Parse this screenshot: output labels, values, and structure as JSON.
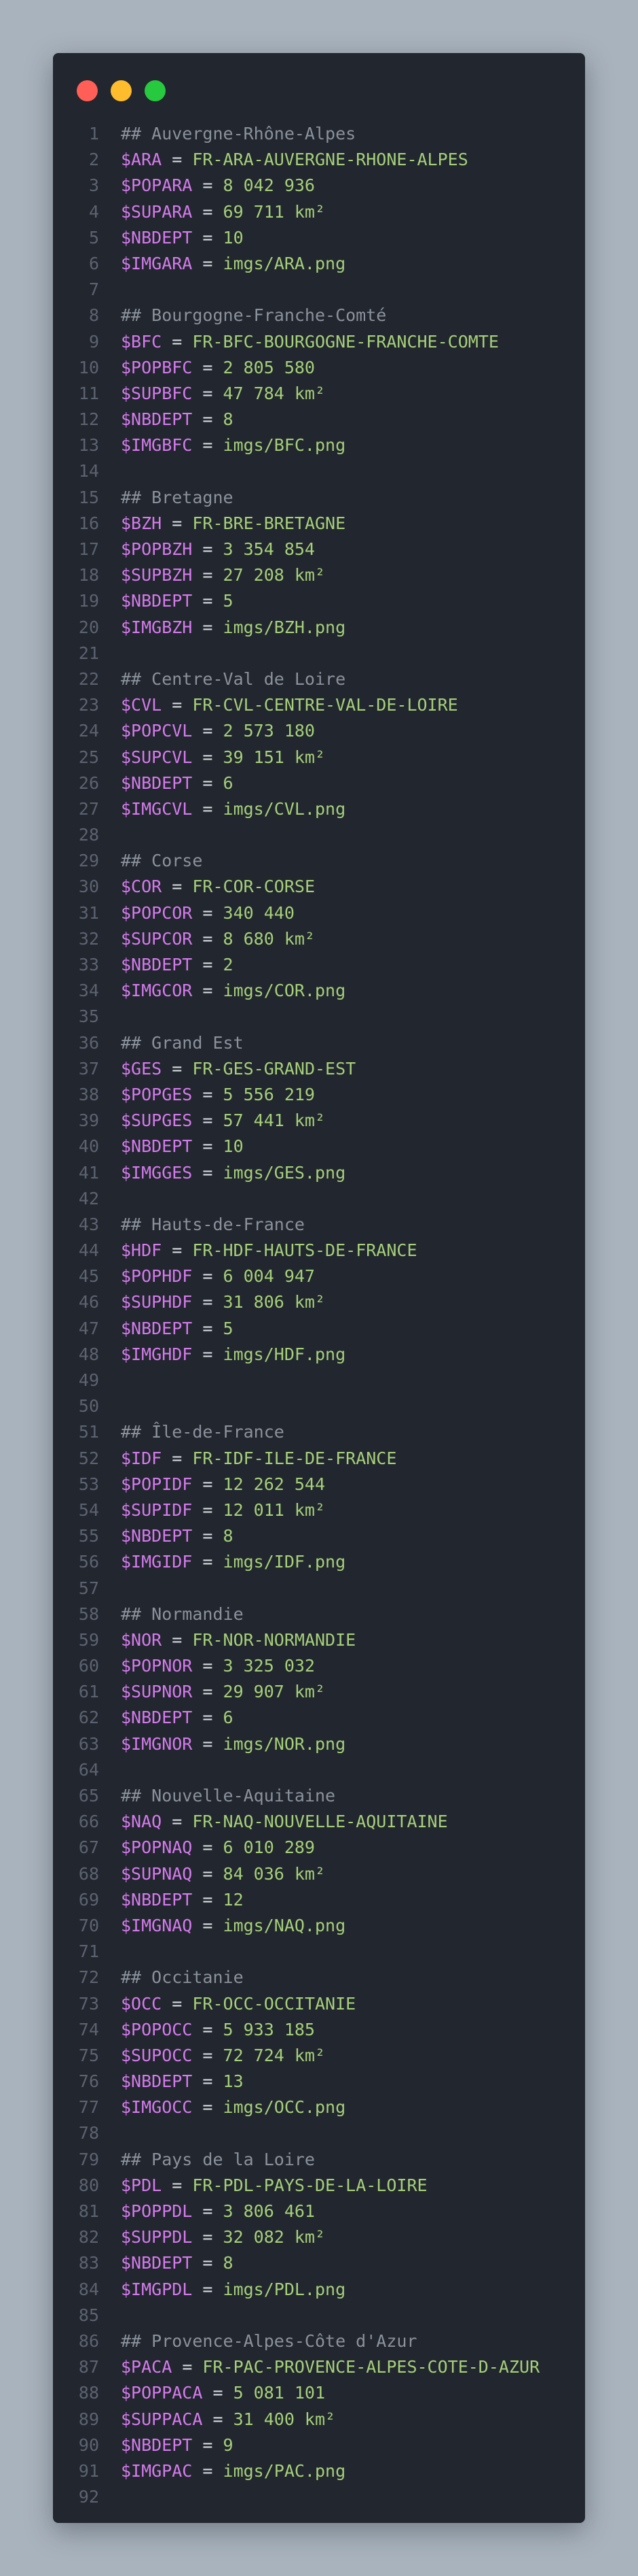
{
  "window": {
    "controls": [
      "close",
      "minimize",
      "maximize"
    ],
    "colors": {
      "close": "#ff5f56",
      "minimize": "#ffbd2e",
      "maximize": "#27c93f"
    }
  },
  "editor": {
    "lines": [
      {
        "n": "1",
        "type": "comment",
        "text": "## Auvergne-Rhône-Alpes"
      },
      {
        "n": "2",
        "type": "assign",
        "var": "$ARA",
        "op": " = ",
        "val": "FR-ARA-AUVERGNE-RHONE-ALPES"
      },
      {
        "n": "3",
        "type": "assign",
        "var": "$POPARA",
        "op": " = ",
        "val": "8 042 936"
      },
      {
        "n": "4",
        "type": "assign",
        "var": "$SUPARA",
        "op": " = ",
        "val": "69 711 km²"
      },
      {
        "n": "5",
        "type": "assign",
        "var": "$NBDEPT",
        "op": " = ",
        "val": "10"
      },
      {
        "n": "6",
        "type": "assign",
        "var": "$IMGARA",
        "op": " = ",
        "val": "imgs/ARA.png"
      },
      {
        "n": "7",
        "type": "blank"
      },
      {
        "n": "8",
        "type": "comment",
        "text": "## Bourgogne-Franche-Comté"
      },
      {
        "n": "9",
        "type": "assign",
        "var": "$BFC",
        "op": " = ",
        "val": "FR-BFC-BOURGOGNE-FRANCHE-COMTE"
      },
      {
        "n": "10",
        "type": "assign",
        "var": "$POPBFC",
        "op": " = ",
        "val": "2 805 580"
      },
      {
        "n": "11",
        "type": "assign",
        "var": "$SUPBFC",
        "op": " = ",
        "val": "47 784 km²"
      },
      {
        "n": "12",
        "type": "assign",
        "var": "$NBDEPT",
        "op": " = ",
        "val": "8"
      },
      {
        "n": "13",
        "type": "assign",
        "var": "$IMGBFC",
        "op": " = ",
        "val": "imgs/BFC.png"
      },
      {
        "n": "14",
        "type": "blank"
      },
      {
        "n": "15",
        "type": "comment",
        "text": "## Bretagne"
      },
      {
        "n": "16",
        "type": "assign",
        "var": "$BZH",
        "op": " = ",
        "val": "FR-BRE-BRETAGNE"
      },
      {
        "n": "17",
        "type": "assign",
        "var": "$POPBZH",
        "op": " = ",
        "val": "3 354 854"
      },
      {
        "n": "18",
        "type": "assign",
        "var": "$SUPBZH",
        "op": " = ",
        "val": "27 208 km²"
      },
      {
        "n": "19",
        "type": "assign",
        "var": "$NBDEPT",
        "op": " = ",
        "val": "5"
      },
      {
        "n": "20",
        "type": "assign",
        "var": "$IMGBZH",
        "op": " = ",
        "val": "imgs/BZH.png"
      },
      {
        "n": "21",
        "type": "blank"
      },
      {
        "n": "22",
        "type": "comment",
        "text": "## Centre-Val de Loire"
      },
      {
        "n": "23",
        "type": "assign",
        "var": "$CVL",
        "op": " = ",
        "val": "FR-CVL-CENTRE-VAL-DE-LOIRE"
      },
      {
        "n": "24",
        "type": "assign",
        "var": "$POPCVL",
        "op": " = ",
        "val": "2 573 180"
      },
      {
        "n": "25",
        "type": "assign",
        "var": "$SUPCVL",
        "op": " = ",
        "val": "39 151 km²"
      },
      {
        "n": "26",
        "type": "assign",
        "var": "$NBDEPT",
        "op": " = ",
        "val": "6"
      },
      {
        "n": "27",
        "type": "assign",
        "var": "$IMGCVL",
        "op": " = ",
        "val": "imgs/CVL.png"
      },
      {
        "n": "28",
        "type": "blank"
      },
      {
        "n": "29",
        "type": "comment",
        "text": "## Corse"
      },
      {
        "n": "30",
        "type": "assign",
        "var": "$COR",
        "op": " = ",
        "val": "FR-COR-CORSE"
      },
      {
        "n": "31",
        "type": "assign",
        "var": "$POPCOR",
        "op": " = ",
        "val": "340 440"
      },
      {
        "n": "32",
        "type": "assign",
        "var": "$SUPCOR",
        "op": " = ",
        "val": "8 680 km²"
      },
      {
        "n": "33",
        "type": "assign",
        "var": "$NBDEPT",
        "op": " = ",
        "val": "2"
      },
      {
        "n": "34",
        "type": "assign",
        "var": "$IMGCOR",
        "op": " = ",
        "val": "imgs/COR.png"
      },
      {
        "n": "35",
        "type": "blank"
      },
      {
        "n": "36",
        "type": "comment",
        "text": "## Grand Est"
      },
      {
        "n": "37",
        "type": "assign",
        "var": "$GES",
        "op": " = ",
        "val": "FR-GES-GRAND-EST"
      },
      {
        "n": "38",
        "type": "assign",
        "var": "$POPGES",
        "op": " = ",
        "val": "5 556 219"
      },
      {
        "n": "39",
        "type": "assign",
        "var": "$SUPGES",
        "op": " = ",
        "val": "57 441 km²"
      },
      {
        "n": "40",
        "type": "assign",
        "var": "$NBDEPT",
        "op": " = ",
        "val": "10"
      },
      {
        "n": "41",
        "type": "assign",
        "var": "$IMGGES",
        "op": " = ",
        "val": "imgs/GES.png"
      },
      {
        "n": "42",
        "type": "blank"
      },
      {
        "n": "43",
        "type": "comment",
        "text": "## Hauts-de-France"
      },
      {
        "n": "44",
        "type": "assign",
        "var": "$HDF",
        "op": " = ",
        "val": "FR-HDF-HAUTS-DE-FRANCE"
      },
      {
        "n": "45",
        "type": "assign",
        "var": "$POPHDF",
        "op": " = ",
        "val": "6 004 947"
      },
      {
        "n": "46",
        "type": "assign",
        "var": "$SUPHDF",
        "op": " = ",
        "val": "31 806 km²"
      },
      {
        "n": "47",
        "type": "assign",
        "var": "$NBDEPT",
        "op": " = ",
        "val": "5"
      },
      {
        "n": "48",
        "type": "assign",
        "var": "$IMGHDF",
        "op": " = ",
        "val": "imgs/HDF.png"
      },
      {
        "n": "49",
        "type": "blank"
      },
      {
        "n": "50",
        "type": "blank"
      },
      {
        "n": "51",
        "type": "comment",
        "text": "## Île-de-France"
      },
      {
        "n": "52",
        "type": "assign",
        "var": "$IDF",
        "op": " = ",
        "val": "FR-IDF-ILE-DE-FRANCE"
      },
      {
        "n": "53",
        "type": "assign",
        "var": "$POPIDF",
        "op": " = ",
        "val": "12 262 544"
      },
      {
        "n": "54",
        "type": "assign",
        "var": "$SUPIDF",
        "op": " = ",
        "val": "12 011 km²"
      },
      {
        "n": "55",
        "type": "assign",
        "var": "$NBDEPT",
        "op": " = ",
        "val": "8"
      },
      {
        "n": "56",
        "type": "assign",
        "var": "$IMGIDF",
        "op": " = ",
        "val": "imgs/IDF.png"
      },
      {
        "n": "57",
        "type": "blank"
      },
      {
        "n": "58",
        "type": "comment",
        "text": "## Normandie"
      },
      {
        "n": "59",
        "type": "assign",
        "var": "$NOR",
        "op": " = ",
        "val": "FR-NOR-NORMANDIE"
      },
      {
        "n": "60",
        "type": "assign",
        "var": "$POPNOR",
        "op": " = ",
        "val": "3 325 032"
      },
      {
        "n": "61",
        "type": "assign",
        "var": "$SUPNOR",
        "op": " = ",
        "val": "29 907 km²"
      },
      {
        "n": "62",
        "type": "assign",
        "var": "$NBDEPT",
        "op": " = ",
        "val": "6"
      },
      {
        "n": "63",
        "type": "assign",
        "var": "$IMGNOR",
        "op": " = ",
        "val": "imgs/NOR.png"
      },
      {
        "n": "64",
        "type": "blank"
      },
      {
        "n": "65",
        "type": "comment",
        "text": "## Nouvelle-Aquitaine"
      },
      {
        "n": "66",
        "type": "assign",
        "var": "$NAQ",
        "op": " = ",
        "val": "FR-NAQ-NOUVELLE-AQUITAINE"
      },
      {
        "n": "67",
        "type": "assign",
        "var": "$POPNAQ",
        "op": " = ",
        "val": "6 010 289"
      },
      {
        "n": "68",
        "type": "assign",
        "var": "$SUPNAQ",
        "op": " = ",
        "val": "84 036 km²"
      },
      {
        "n": "69",
        "type": "assign",
        "var": "$NBDEPT",
        "op": " = ",
        "val": "12"
      },
      {
        "n": "70",
        "type": "assign",
        "var": "$IMGNAQ",
        "op": " = ",
        "val": "imgs/NAQ.png"
      },
      {
        "n": "71",
        "type": "blank"
      },
      {
        "n": "72",
        "type": "comment",
        "text": "## Occitanie"
      },
      {
        "n": "73",
        "type": "assign",
        "var": "$OCC",
        "op": " = ",
        "val": "FR-OCC-OCCITANIE"
      },
      {
        "n": "74",
        "type": "assign",
        "var": "$POPOCC",
        "op": " = ",
        "val": "5 933 185"
      },
      {
        "n": "75",
        "type": "assign",
        "var": "$SUPOCC",
        "op": " = ",
        "val": "72 724 km²"
      },
      {
        "n": "76",
        "type": "assign",
        "var": "$NBDEPT",
        "op": " = ",
        "val": "13"
      },
      {
        "n": "77",
        "type": "assign",
        "var": "$IMGOCC",
        "op": " = ",
        "val": "imgs/OCC.png"
      },
      {
        "n": "78",
        "type": "blank"
      },
      {
        "n": "79",
        "type": "comment",
        "text": "## Pays de la Loire"
      },
      {
        "n": "80",
        "type": "assign",
        "var": "$PDL",
        "op": " = ",
        "val": "FR-PDL-PAYS-DE-LA-LOIRE"
      },
      {
        "n": "81",
        "type": "assign",
        "var": "$POPPDL",
        "op": " = ",
        "val": "3 806 461"
      },
      {
        "n": "82",
        "type": "assign",
        "var": "$SUPPDL",
        "op": " = ",
        "val": "32 082 km²"
      },
      {
        "n": "83",
        "type": "assign",
        "var": "$NBDEPT",
        "op": " = ",
        "val": "8"
      },
      {
        "n": "84",
        "type": "assign",
        "var": "$IMGPDL",
        "op": " = ",
        "val": "imgs/PDL.png"
      },
      {
        "n": "85",
        "type": "blank"
      },
      {
        "n": "86",
        "type": "comment",
        "text": "## Provence-Alpes-Côte d'Azur"
      },
      {
        "n": "87",
        "type": "assign",
        "var": "$PACA",
        "op": " = ",
        "val": "FR-PAC-PROVENCE-ALPES-COTE-D-AZUR"
      },
      {
        "n": "88",
        "type": "assign",
        "var": "$POPPACA",
        "op": " = ",
        "val": "5 081 101"
      },
      {
        "n": "89",
        "type": "assign",
        "var": "$SUPPACA",
        "op": " = ",
        "val": "31 400 km²"
      },
      {
        "n": "90",
        "type": "assign",
        "var": "$NBDEPT",
        "op": " = ",
        "val": "9"
      },
      {
        "n": "91",
        "type": "assign",
        "var": "$IMGPAC",
        "op": " = ",
        "val": "imgs/PAC.png"
      },
      {
        "n": "92",
        "type": "blank"
      }
    ]
  }
}
